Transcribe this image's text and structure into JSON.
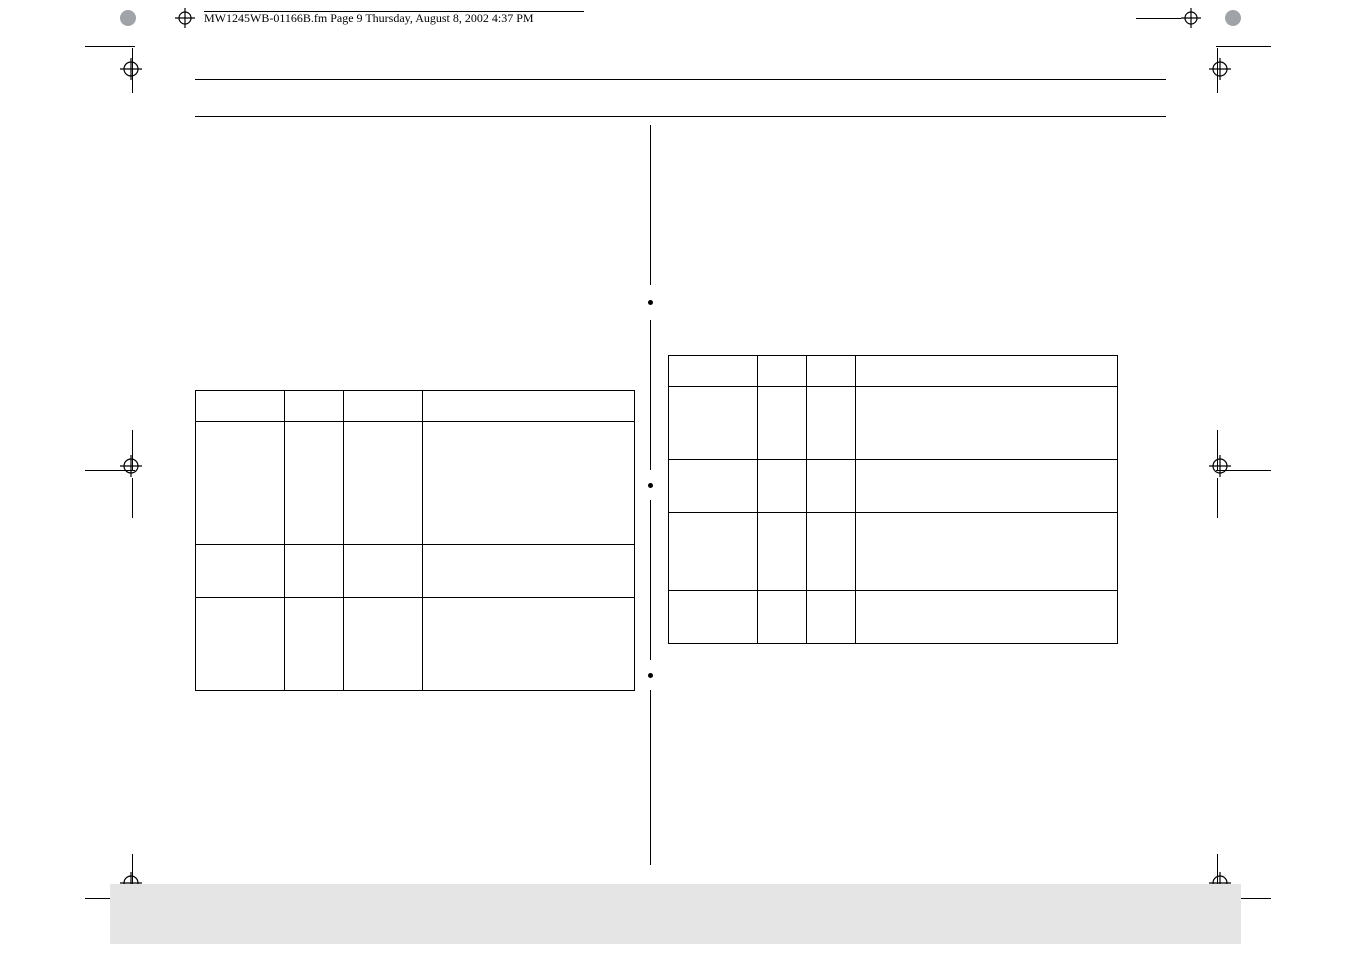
{
  "banner": {
    "text": "MW1245WB-01166B.fm  Page 9  Thursday, August 8, 2002  4:37 PM"
  },
  "left_table": {
    "headers": [
      "",
      "",
      "",
      ""
    ],
    "rows": [
      [
        "",
        "",
        "",
        ""
      ],
      [
        "",
        "",
        "",
        ""
      ],
      [
        "",
        "",
        "",
        ""
      ]
    ]
  },
  "right_table": {
    "headers": [
      "",
      "",
      "",
      ""
    ],
    "rows": [
      [
        "",
        "",
        "",
        ""
      ],
      [
        "",
        "",
        "",
        ""
      ],
      [
        "",
        "",
        "",
        ""
      ],
      [
        "",
        "",
        "",
        ""
      ]
    ]
  }
}
